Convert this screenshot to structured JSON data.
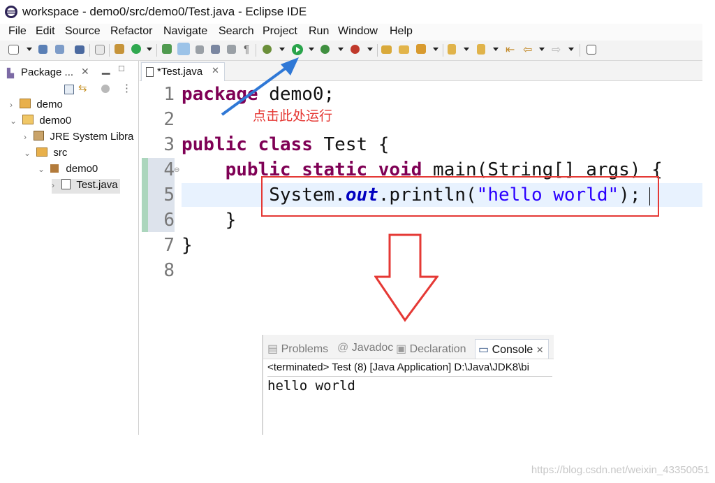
{
  "window": {
    "title": "workspace - demo0/src/demo0/Test.java - Eclipse IDE"
  },
  "menu": [
    "File",
    "Edit",
    "Source",
    "Refactor",
    "Navigate",
    "Search",
    "Project",
    "Run",
    "Window",
    "Help"
  ],
  "package_explorer": {
    "tab_label": "Package ...",
    "tree": [
      {
        "label": "demo"
      },
      {
        "label": "demo0"
      },
      {
        "label": "JRE System Libra"
      },
      {
        "label": "src"
      },
      {
        "label": "demo0"
      },
      {
        "label": "Test.java"
      }
    ]
  },
  "editor": {
    "tab_label": "*Test.java",
    "line_numbers": [
      "1",
      "2",
      "3",
      "4",
      "5",
      "6",
      "7",
      "8"
    ],
    "code": {
      "l1_kw": "package",
      "l1_rest": " demo0;",
      "l3_kw1": "public",
      "l3_kw2": "class",
      "l3_rest": " Test {",
      "l4_kw1": "public",
      "l4_kw2": "static",
      "l4_kw3": "void",
      "l4_rest": " main(String[] args) {",
      "l5_a": "System.",
      "l5_field": "out",
      "l5_b": ".println(",
      "l5_str": "\"hello world\"",
      "l5_c": ");",
      "l6": "}",
      "l7": "}"
    }
  },
  "annotation": {
    "run_hint": "点击此处运行",
    "colors": {
      "highlight_box": "#e53935",
      "arrow_blue": "#2f78d6",
      "arrow_red": "#e53935"
    }
  },
  "console": {
    "tabs": [
      "Problems",
      "Javadoc",
      "Declaration",
      "Console"
    ],
    "status": "<terminated> Test (8) [Java Application] D:\\Java\\JDK8\\bi",
    "output": "hello world"
  },
  "watermark": "https://blog.csdn.net/weixin_43350051",
  "colors": {
    "keyword": "#7f0055",
    "string": "#2a00ff",
    "field": "#0000c0"
  }
}
